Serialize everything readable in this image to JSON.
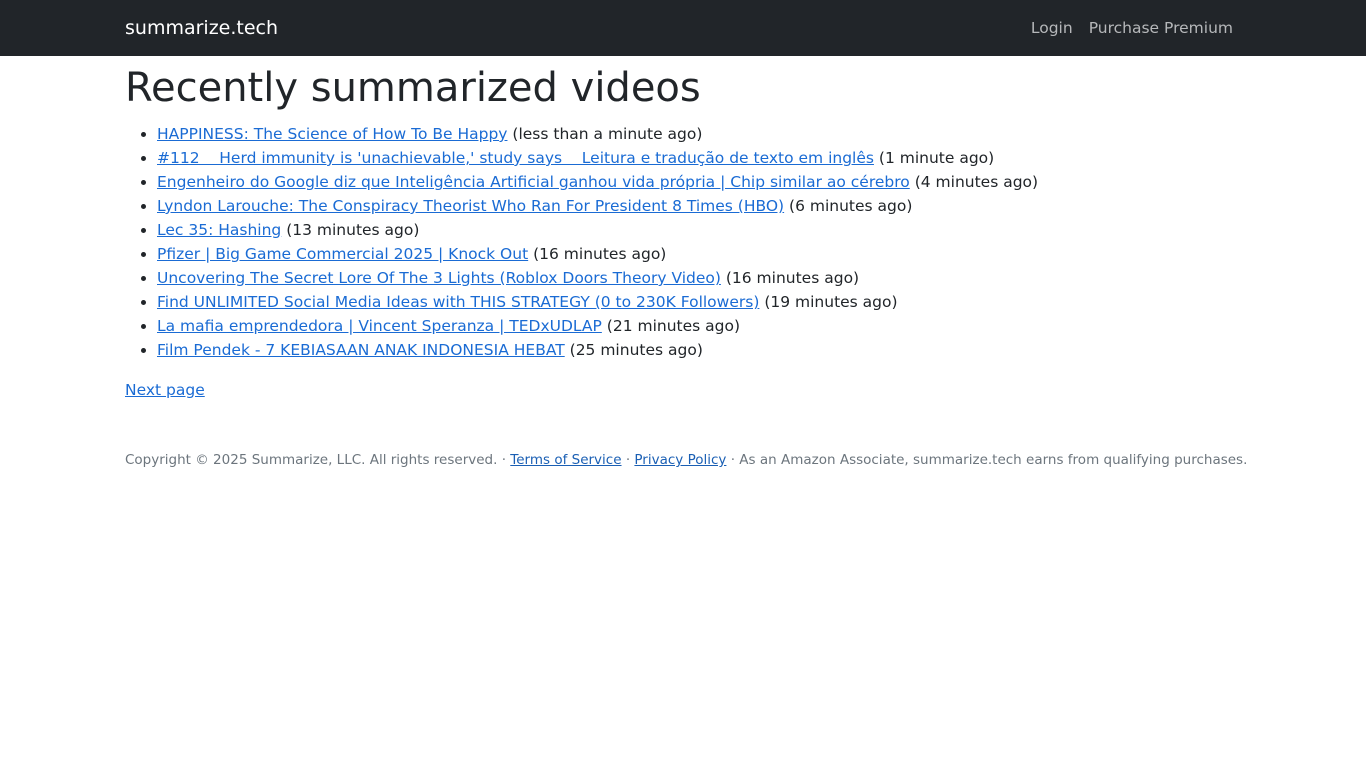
{
  "navbar": {
    "brand": "summarize.tech",
    "login": "Login",
    "premium": "Purchase Premium"
  },
  "main": {
    "title": "Recently summarized videos",
    "videos": [
      {
        "title": "HAPPINESS: The Science of How To Be Happy",
        "ago": "(less than a minute ago)"
      },
      {
        "title": "#112    Herd immunity is 'unachievable,' study says    Leitura e tradução de texto em inglês",
        "ago": "(1 minute ago)"
      },
      {
        "title": "Engenheiro do Google diz que Inteligência Artificial ganhou vida própria | Chip similar ao cérebro",
        "ago": "(4 minutes ago)"
      },
      {
        "title": "Lyndon Larouche: The Conspiracy Theorist Who Ran For President 8 Times (HBO)",
        "ago": "(6 minutes ago)"
      },
      {
        "title": "Lec 35: Hashing",
        "ago": "(13 minutes ago)"
      },
      {
        "title": "Pfizer | Big Game Commercial 2025 | Knock Out",
        "ago": "(16 minutes ago)"
      },
      {
        "title": "Uncovering The Secret Lore Of The 3 Lights (Roblox Doors Theory Video)",
        "ago": "(16 minutes ago)"
      },
      {
        "title": "Find UNLIMITED Social Media Ideas with THIS STRATEGY (0 to 230K Followers)",
        "ago": "(19 minutes ago)"
      },
      {
        "title": "La mafia emprendedora | Vincent Speranza | TEDxUDLAP",
        "ago": "(21 minutes ago)"
      },
      {
        "title": "Film Pendek - 7 KEBIASAAN ANAK INDONESIA HEBAT",
        "ago": "(25 minutes ago)"
      }
    ],
    "next_page": "Next page"
  },
  "footer": {
    "copyright": "Copyright © 2025 Summarize, LLC. All rights reserved.",
    "sep": " · ",
    "terms": "Terms of Service",
    "privacy": "Privacy Policy",
    "amazon": "As an Amazon Associate, summarize.tech earns from qualifying purchases."
  }
}
